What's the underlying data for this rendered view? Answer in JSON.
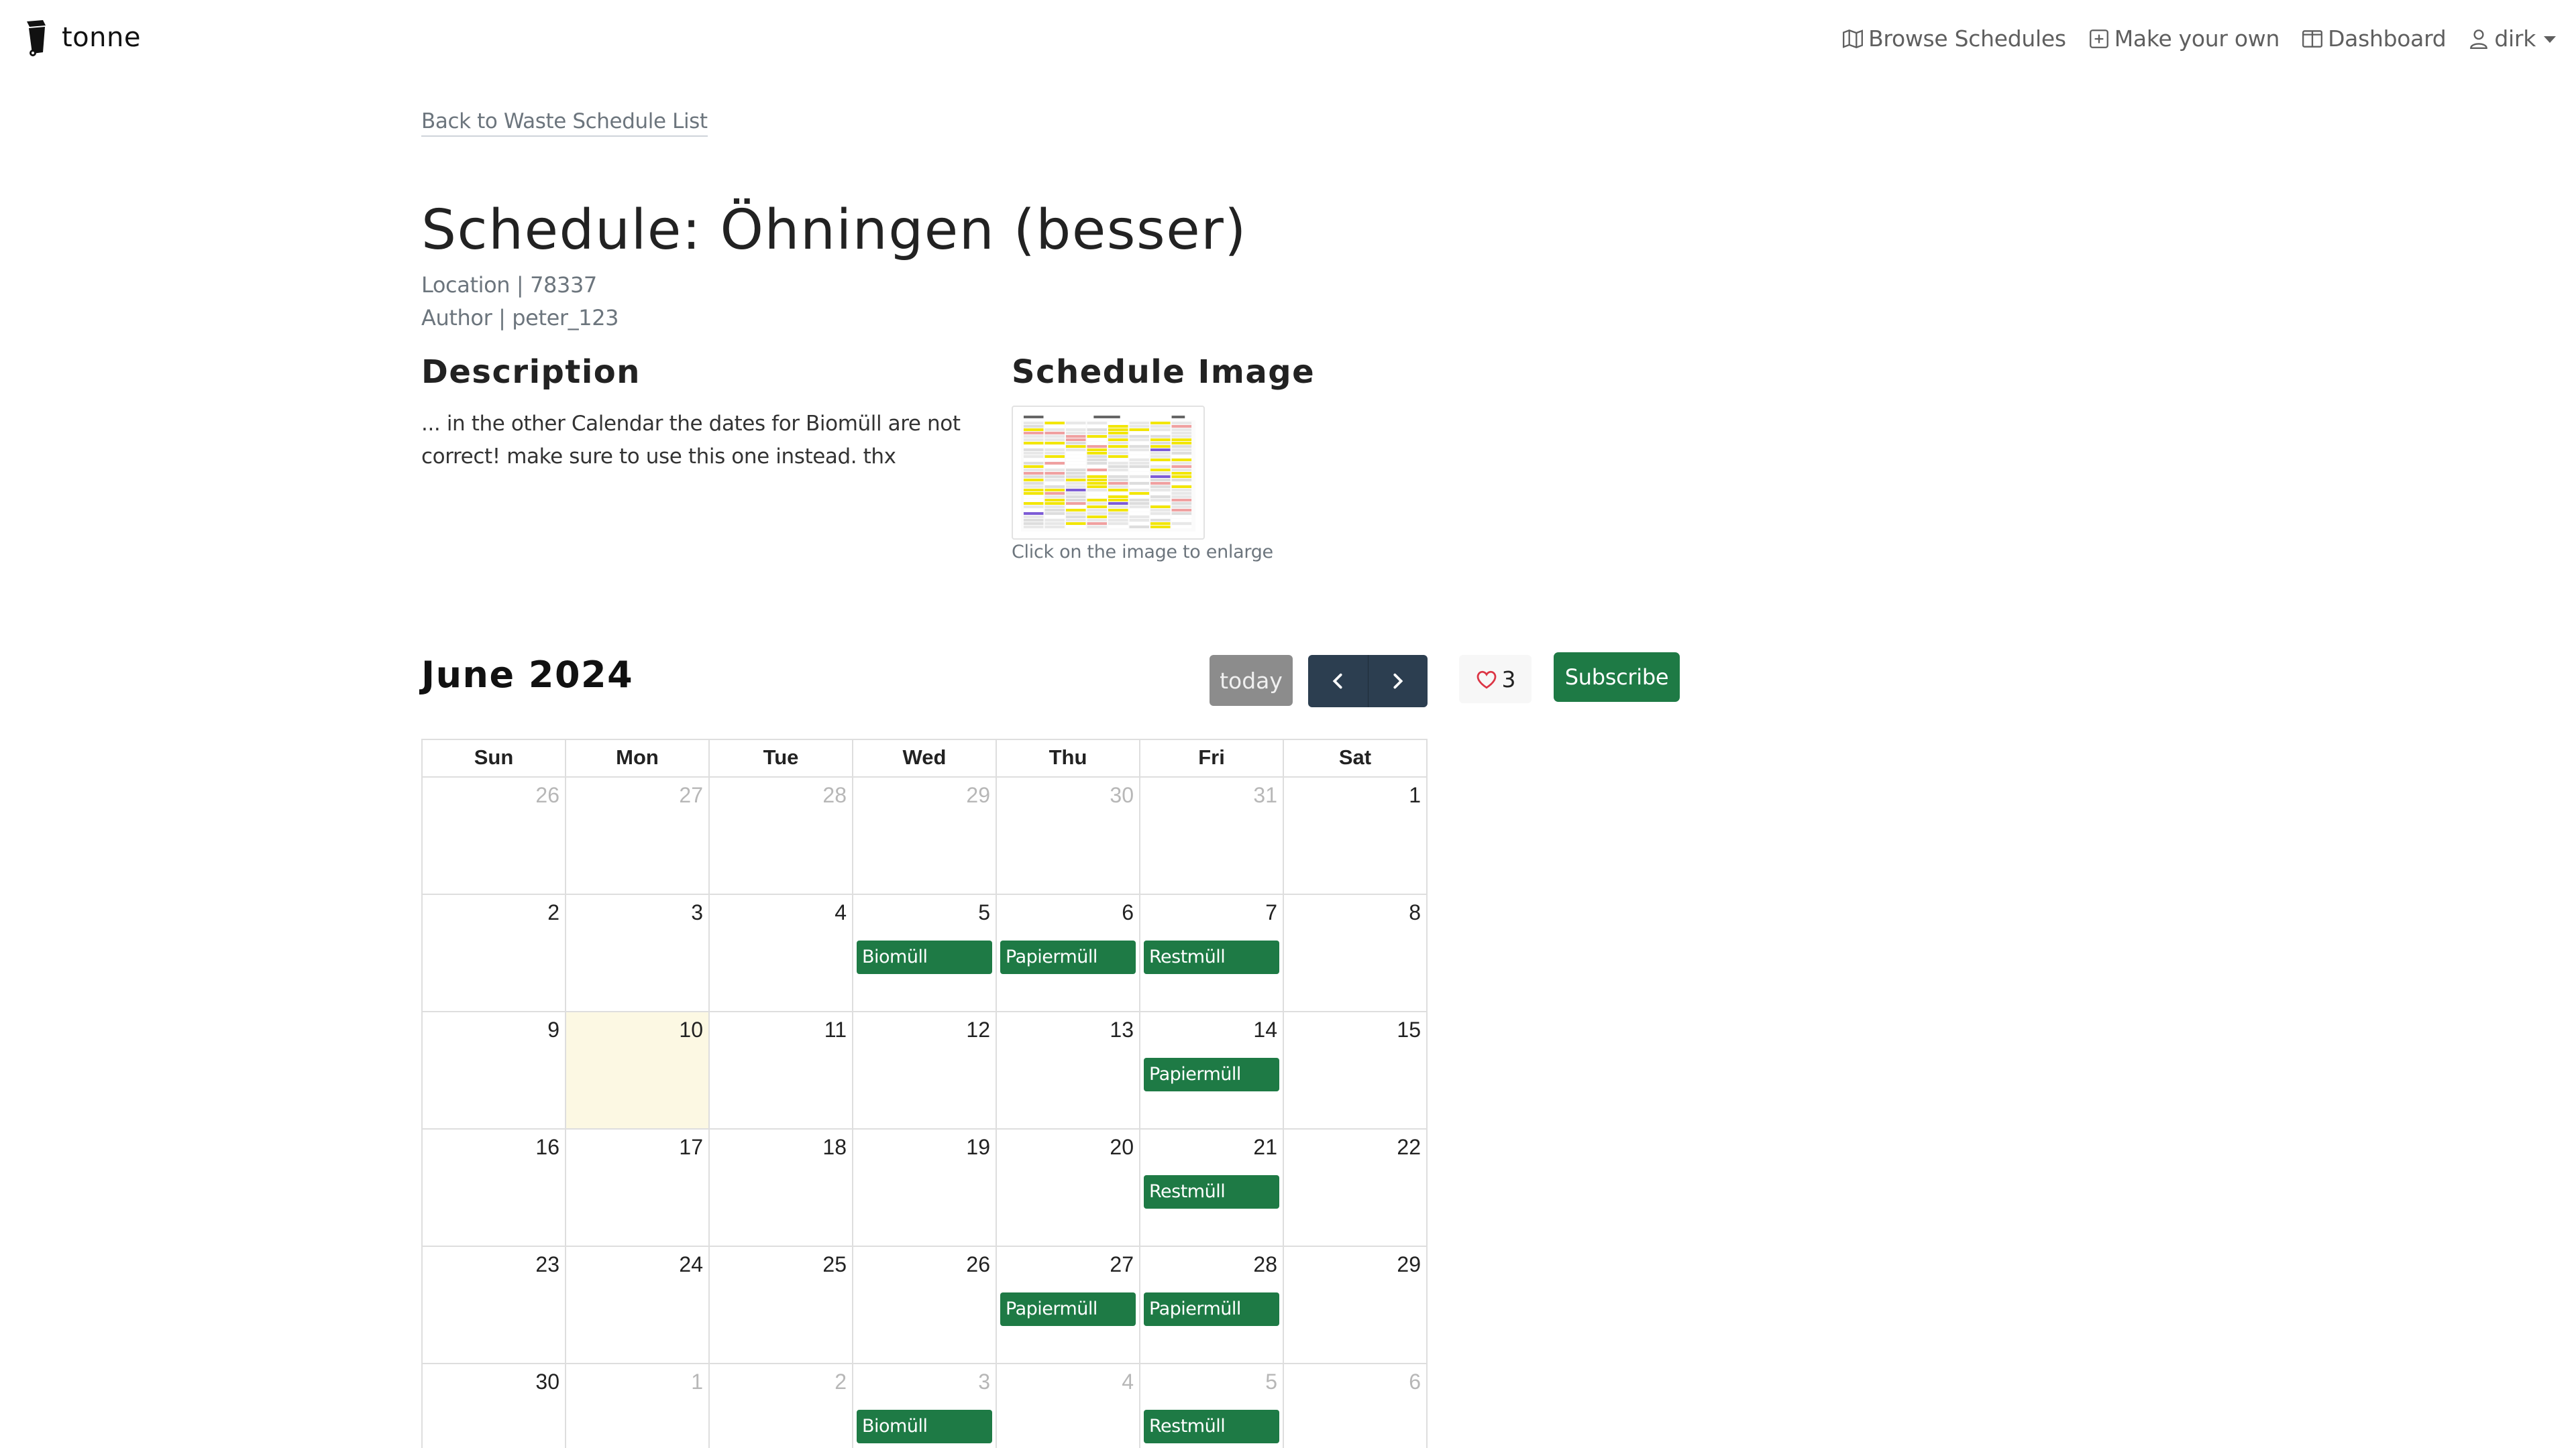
{
  "nav": {
    "brand": "tonne",
    "links": [
      {
        "label": "Browse Schedules",
        "icon": "map-icon"
      },
      {
        "label": "Make your own",
        "icon": "plus-square-icon"
      },
      {
        "label": "Dashboard",
        "icon": "columns-icon"
      },
      {
        "label": "dirk",
        "icon": "person-icon"
      }
    ]
  },
  "page": {
    "back_link": "Back to Waste Schedule List",
    "title": "Schedule: Öhningen (besser)",
    "location": "Location | 78337",
    "author": "Author | peter_123",
    "description_title": "Description",
    "description": "... in the other Calendar the dates for Biomüll are not correct! make sure to use this one instead. thx",
    "image_title": "Schedule Image",
    "image_caption": "Click on the image to enlarge"
  },
  "calendar": {
    "month_label": "June 2024",
    "today_label": "today",
    "favorites_count": "3",
    "subscribe_label": "Subscribe",
    "weekdays": [
      "Sun",
      "Mon",
      "Tue",
      "Wed",
      "Thu",
      "Fri",
      "Sat"
    ],
    "weeks": [
      [
        {
          "d": "26",
          "o": true
        },
        {
          "d": "27",
          "o": true
        },
        {
          "d": "28",
          "o": true
        },
        {
          "d": "29",
          "o": true
        },
        {
          "d": "30",
          "o": true
        },
        {
          "d": "31",
          "o": true
        },
        {
          "d": "1"
        }
      ],
      [
        {
          "d": "2"
        },
        {
          "d": "3"
        },
        {
          "d": "4"
        },
        {
          "d": "5",
          "e": "Biomüll"
        },
        {
          "d": "6",
          "e": "Papiermüll"
        },
        {
          "d": "7",
          "e": "Restmüll"
        },
        {
          "d": "8"
        }
      ],
      [
        {
          "d": "9"
        },
        {
          "d": "10",
          "today": true
        },
        {
          "d": "11"
        },
        {
          "d": "12"
        },
        {
          "d": "13"
        },
        {
          "d": "14",
          "e": "Papiermüll"
        },
        {
          "d": "15"
        }
      ],
      [
        {
          "d": "16"
        },
        {
          "d": "17"
        },
        {
          "d": "18"
        },
        {
          "d": "19"
        },
        {
          "d": "20"
        },
        {
          "d": "21",
          "e": "Restmüll"
        },
        {
          "d": "22"
        }
      ],
      [
        {
          "d": "23"
        },
        {
          "d": "24"
        },
        {
          "d": "25"
        },
        {
          "d": "26"
        },
        {
          "d": "27",
          "e": "Papiermüll"
        },
        {
          "d": "28",
          "e": "Papiermüll"
        },
        {
          "d": "29"
        }
      ],
      [
        {
          "d": "30"
        },
        {
          "d": "1",
          "o": true
        },
        {
          "d": "2",
          "o": true
        },
        {
          "d": "3",
          "o": true,
          "e": "Biomüll"
        },
        {
          "d": "4",
          "o": true
        },
        {
          "d": "5",
          "o": true,
          "e": "Restmüll"
        },
        {
          "d": "6",
          "o": true
        }
      ]
    ]
  },
  "colors": {
    "event_green": "#1e7a45",
    "nav_dark": "#2c3e50",
    "today_bg": "#fcf8e3"
  }
}
